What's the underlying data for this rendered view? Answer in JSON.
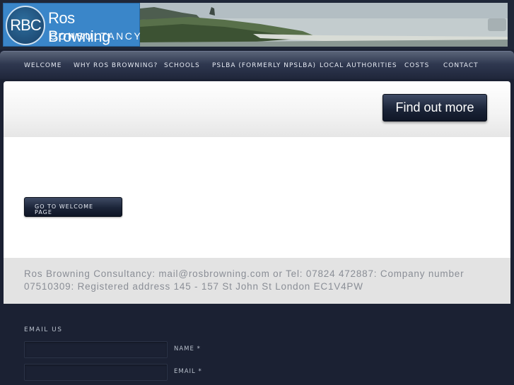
{
  "header": {
    "logo_mark": "RBC",
    "logo_name": "Ros Browning",
    "logo_sub": "CONSULTANCY"
  },
  "nav": {
    "items": [
      {
        "label": "WELCOME"
      },
      {
        "label": "WHY ROS BROWNING?"
      },
      {
        "label": "SCHOOLS"
      },
      {
        "label": "PSLBA (FORMERLY NPSLBA)"
      },
      {
        "label": "LOCAL AUTHORITIES"
      },
      {
        "label": "COSTS"
      },
      {
        "label": "CONTACT"
      }
    ]
  },
  "hero": {
    "find_out_more_label": "Find out more"
  },
  "main": {
    "welcome_button_line1": "GO TO WELCOME",
    "welcome_button_line2": "PAGE"
  },
  "footer_info": {
    "text_line1": "Ros Browning Consultancy: mail@rosbrowning.com or Tel: 07824 472887: Company number",
    "text_line2": "07510309: Registered address 145 - 157 St John St London EC1V4PW"
  },
  "contact_form": {
    "heading": "EMAIL US",
    "name_label": "NAME *",
    "email_label": "EMAIL *",
    "name_value": "",
    "email_value": ""
  },
  "colors": {
    "page_background": "#1b2133",
    "button_dark": "#1b2438",
    "logo_blue": "#3a86c9",
    "footer_text": "#8a8e96"
  }
}
